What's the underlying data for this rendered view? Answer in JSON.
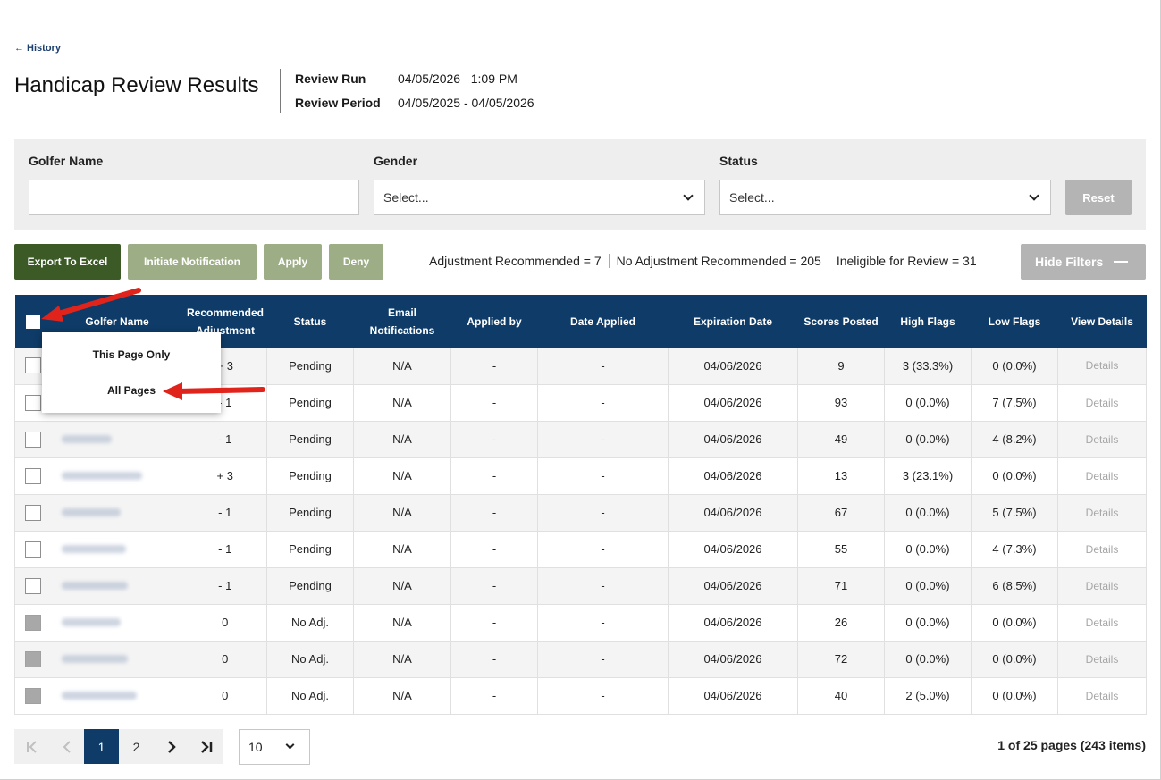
{
  "nav": {
    "back_label": "← History"
  },
  "header": {
    "title": "Handicap Review Results",
    "review_run_label": "Review Run",
    "review_run_value": "04/05/2026   1:09 PM",
    "review_period_label": "Review Period",
    "review_period_value": "04/05/2025 - 04/05/2026"
  },
  "filters": {
    "golfer_name_label": "Golfer Name",
    "golfer_name_value": "",
    "gender_label": "Gender",
    "gender_value": "Select...",
    "status_label": "Status",
    "status_value": "Select...",
    "reset_label": "Reset"
  },
  "actions": {
    "export_label": "Export To Excel",
    "initiate_label": "Initiate Notification",
    "apply_label": "Apply",
    "deny_label": "Deny",
    "hide_filters_label": "Hide Filters"
  },
  "summary": {
    "adjustment_recommended": "Adjustment Recommended = 7",
    "no_adjustment_recommended": "No Adjustment Recommended = 205",
    "ineligible": "Ineligible for Review = 31"
  },
  "table": {
    "headers": [
      "Golfer Name",
      "Recommended Adjustment",
      "Status",
      "Email Notifications",
      "Applied by",
      "Date Applied",
      "Expiration Date",
      "Scores Posted",
      "High Flags",
      "Low Flags",
      "View Details"
    ],
    "rows": [
      {
        "adjustment": "+ 3",
        "status": "Pending",
        "email": "N/A",
        "applied_by": "-",
        "date_applied": "-",
        "expiration": "04/06/2026",
        "scores": "9",
        "high": "3 (33.3%)",
        "low": "0 (0.0%)",
        "details": "Details"
      },
      {
        "adjustment": "- 1",
        "status": "Pending",
        "email": "N/A",
        "applied_by": "-",
        "date_applied": "-",
        "expiration": "04/06/2026",
        "scores": "93",
        "high": "0 (0.0%)",
        "low": "7 (7.5%)",
        "details": "Details"
      },
      {
        "adjustment": "- 1",
        "status": "Pending",
        "email": "N/A",
        "applied_by": "-",
        "date_applied": "-",
        "expiration": "04/06/2026",
        "scores": "49",
        "high": "0 (0.0%)",
        "low": "4 (8.2%)",
        "details": "Details"
      },
      {
        "adjustment": "+ 3",
        "status": "Pending",
        "email": "N/A",
        "applied_by": "-",
        "date_applied": "-",
        "expiration": "04/06/2026",
        "scores": "13",
        "high": "3 (23.1%)",
        "low": "0 (0.0%)",
        "details": "Details"
      },
      {
        "adjustment": "- 1",
        "status": "Pending",
        "email": "N/A",
        "applied_by": "-",
        "date_applied": "-",
        "expiration": "04/06/2026",
        "scores": "67",
        "high": "0 (0.0%)",
        "low": "5 (7.5%)",
        "details": "Details"
      },
      {
        "adjustment": "- 1",
        "status": "Pending",
        "email": "N/A",
        "applied_by": "-",
        "date_applied": "-",
        "expiration": "04/06/2026",
        "scores": "55",
        "high": "0 (0.0%)",
        "low": "4 (7.3%)",
        "details": "Details"
      },
      {
        "adjustment": "- 1",
        "status": "Pending",
        "email": "N/A",
        "applied_by": "-",
        "date_applied": "-",
        "expiration": "04/06/2026",
        "scores": "71",
        "high": "0 (0.0%)",
        "low": "6 (8.5%)",
        "details": "Details"
      },
      {
        "adjustment": "0",
        "status": "No Adj.",
        "email": "N/A",
        "applied_by": "-",
        "date_applied": "-",
        "expiration": "04/06/2026",
        "scores": "26",
        "high": "0 (0.0%)",
        "low": "0 (0.0%)",
        "details": "Details"
      },
      {
        "adjustment": "0",
        "status": "No Adj.",
        "email": "N/A",
        "applied_by": "-",
        "date_applied": "-",
        "expiration": "04/06/2026",
        "scores": "72",
        "high": "0 (0.0%)",
        "low": "0 (0.0%)",
        "details": "Details"
      },
      {
        "adjustment": "0",
        "status": "No Adj.",
        "email": "N/A",
        "applied_by": "-",
        "date_applied": "-",
        "expiration": "04/06/2026",
        "scores": "40",
        "high": "2 (5.0%)",
        "low": "0 (0.0%)",
        "details": "Details"
      }
    ]
  },
  "select_menu": {
    "this_page": "This Page Only",
    "all_pages": "All Pages"
  },
  "pagination": {
    "pages": [
      "1",
      "2"
    ],
    "current_page": "1",
    "page_size": "10",
    "info": "1 of 25 pages (243 items)"
  },
  "colors": {
    "header_navy": "#0e3b67",
    "export_green": "#3b5a26",
    "disabled_green": "#9dae87",
    "annotation_red": "#e0231b"
  }
}
